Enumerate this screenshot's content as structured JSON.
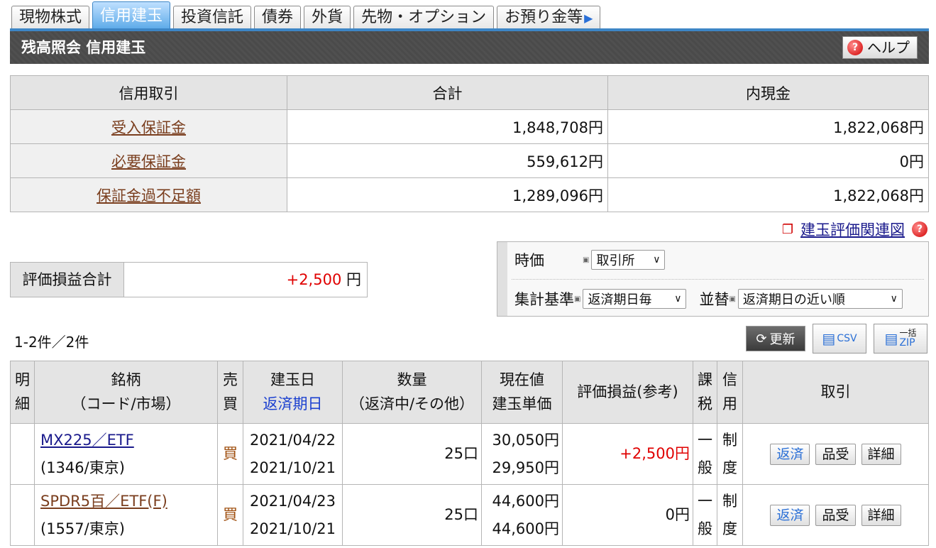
{
  "tabs": [
    {
      "label": "現物株式",
      "active": false
    },
    {
      "label": "信用建玉",
      "active": true
    },
    {
      "label": "投資信託",
      "active": false
    },
    {
      "label": "債券",
      "active": false
    },
    {
      "label": "外貨",
      "active": false
    },
    {
      "label": "先物・オプション",
      "active": false
    },
    {
      "label": "お預り金等",
      "active": false
    }
  ],
  "title": "残高照会 信用建玉",
  "help_label": "ヘルプ",
  "summary": {
    "headers": [
      "信用取引",
      "合計",
      "内現金"
    ],
    "rows": [
      {
        "label": "受入保証金",
        "total": "1,848,708円",
        "cash": "1,822,068円"
      },
      {
        "label": "必要保証金",
        "total": "559,612円",
        "cash": "0円"
      },
      {
        "label": "保証金過不足額",
        "total": "1,289,096円",
        "cash": "1,822,068円"
      }
    ]
  },
  "related_link": "建玉評価関連図",
  "pl_total": {
    "label": "評価損益合計",
    "value": "+2,500",
    "unit": "円"
  },
  "filters": {
    "price_label": "時価",
    "price_value": "取引所",
    "basis_label": "集計基準",
    "basis_value": "返済期日毎",
    "sort_label": "並替",
    "sort_value": "返済期日の近い順"
  },
  "count": "1-2件／2件",
  "toolbar": {
    "update": "更新",
    "csv": "CSV",
    "zip_top": "一括",
    "zip": "ZIP"
  },
  "table": {
    "headers": {
      "detail": [
        "明",
        "細"
      ],
      "name": [
        "銘柄",
        "（コード/市場）"
      ],
      "side": [
        "売",
        "買"
      ],
      "date": [
        "建玉日",
        "返済期日"
      ],
      "qty": [
        "数量",
        "（返済中/その他）"
      ],
      "price": [
        "現在値",
        "建玉単価"
      ],
      "pl": "評価損益(参考)",
      "tax": [
        "課",
        "税"
      ],
      "credit": [
        "信",
        "用"
      ],
      "action": "取引"
    },
    "rows": [
      {
        "name": "MX225／ETF",
        "code": "(1346/東京)",
        "side": "買",
        "open_date": "2021/04/22",
        "due_date": "2021/10/21",
        "qty": "25口",
        "current": "30,050円",
        "cost": "29,950円",
        "pl": "+2,500円",
        "tax": [
          "一",
          "般"
        ],
        "credit": [
          "制",
          "度"
        ],
        "link_color": "#1a1a8c"
      },
      {
        "name": "SPDR5百／ETF(F)",
        "code": "(1557/東京)",
        "side": "買",
        "open_date": "2021/04/23",
        "due_date": "2021/10/21",
        "qty": "25口",
        "current": "44,600円",
        "cost": "44,600円",
        "pl": "0円",
        "tax": [
          "一",
          "般"
        ],
        "credit": [
          "制",
          "度"
        ],
        "link_color": "#7a3e1e"
      }
    ],
    "actions": [
      "返済",
      "品受",
      "詳細"
    ]
  }
}
